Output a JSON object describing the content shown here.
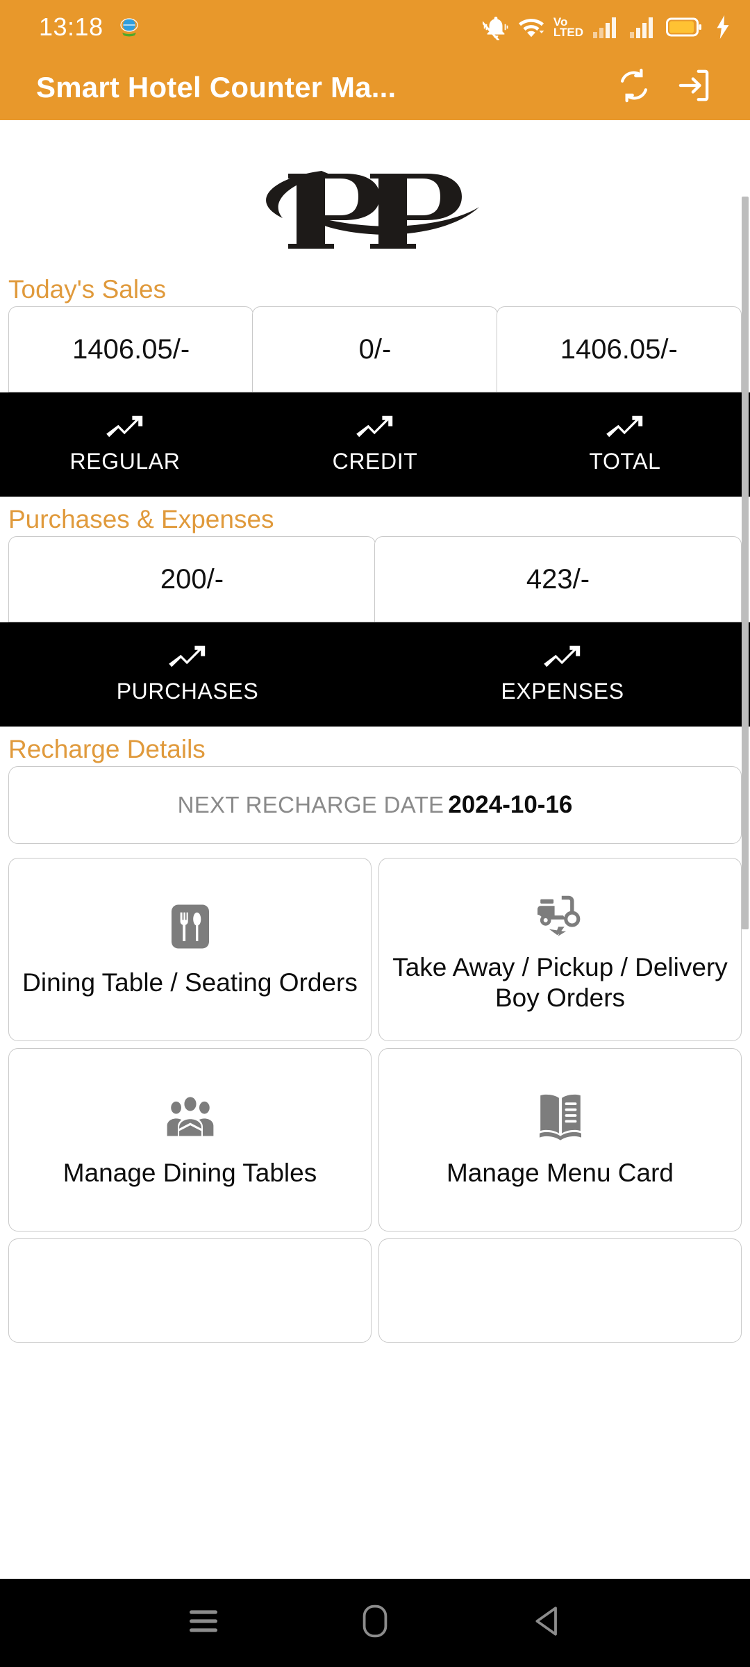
{
  "status_bar": {
    "time": "13:18",
    "notification_icon": "app-notification-icon",
    "icons": [
      "bell-mute-icon",
      "wifi-icon",
      "volte-icon",
      "signal-bars-sim1-icon",
      "signal-bars-sim2-icon",
      "battery-charging-icon"
    ],
    "volte_line1": "Vo",
    "volte_line2": "LTED"
  },
  "app_bar": {
    "title": "Smart Hotel Counter Ma...",
    "sync_icon": "sync-icon",
    "logout_icon": "logout-icon",
    "background_color": "#E8982B"
  },
  "brand": {
    "logo_text": "PP",
    "logo_alt": "PP logo"
  },
  "sales": {
    "heading": "Today's Sales",
    "cards": [
      {
        "value": "1406.05/-",
        "label": "REGULAR",
        "icon": "trending-up-icon"
      },
      {
        "value": "0/-",
        "label": "CREDIT",
        "icon": "trending-up-icon"
      },
      {
        "value": "1406.05/-",
        "label": "TOTAL",
        "icon": "trending-up-icon"
      }
    ]
  },
  "purchases_expenses": {
    "heading": "Purchases & Expenses",
    "cards": [
      {
        "value": "200/-",
        "label": "PURCHASES",
        "icon": "trending-up-icon"
      },
      {
        "value": "423/-",
        "label": "EXPENSES",
        "icon": "trending-up-icon"
      }
    ]
  },
  "recharge": {
    "heading": "Recharge Details",
    "label": "NEXT RECHARGE DATE",
    "date": "2024-10-16"
  },
  "tiles": [
    {
      "label": "Dining Table / Seating Orders",
      "icon": "restaurant-menu-icon"
    },
    {
      "label": "Take Away / Pickup / Delivery Boy Orders",
      "icon": "electric-moped-icon"
    },
    {
      "label": "Manage Dining Tables",
      "icon": "groups-icon"
    },
    {
      "label": "Manage Menu Card",
      "icon": "menu-book-icon"
    }
  ],
  "nav_bar": {
    "recents_icon": "recent-apps-icon",
    "home_icon": "home-icon",
    "back_icon": "back-icon"
  },
  "colors": {
    "accent_orange": "#E8982B",
    "heading_orange": "#E09A3C",
    "footer_black": "#000000",
    "icon_gray": "#7d7d7d",
    "border_gray": "#c9c9c9"
  }
}
